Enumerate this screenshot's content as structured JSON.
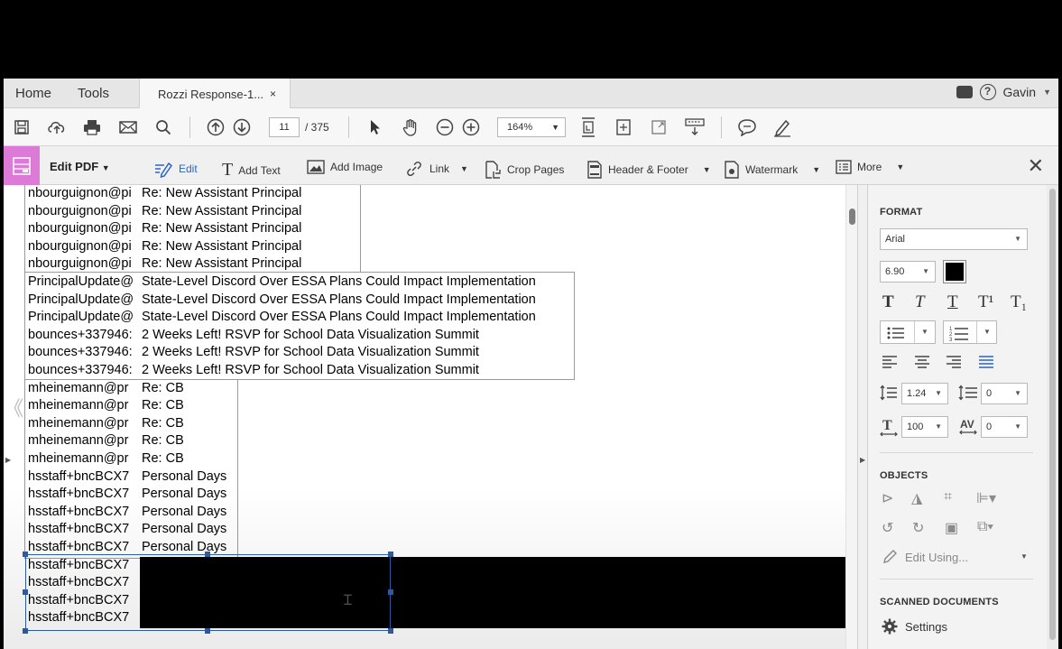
{
  "tabs": {
    "home": "Home",
    "tools": "Tools",
    "document_tab": "Rozzi Response-1...",
    "close_glyph": "×",
    "user": "Gavin"
  },
  "toolbar": {
    "page_current": "11",
    "page_total": "/ 375",
    "zoom": "164%"
  },
  "editbar": {
    "title": "Edit PDF",
    "edit": "Edit",
    "add_text": "Add Text",
    "add_image": "Add Image",
    "link": "Link",
    "crop_pages": "Crop Pages",
    "header_footer": "Header & Footer",
    "watermark": "Watermark",
    "more": "More"
  },
  "document": {
    "rows": [
      {
        "from": "nbourguignon@pi",
        "subject": "Re: New Assistant Principal"
      },
      {
        "from": "nbourguignon@pi",
        "subject": "Re: New Assistant Principal"
      },
      {
        "from": "nbourguignon@pi",
        "subject": "Re: New Assistant Principal"
      },
      {
        "from": "nbourguignon@pi",
        "subject": "Re: New Assistant Principal"
      },
      {
        "from": "nbourguignon@pi",
        "subject": "Re: New Assistant Principal"
      },
      {
        "from": "PrincipalUpdate@",
        "subject": "State-Level Discord Over ESSA Plans Could Impact Implementation"
      },
      {
        "from": "PrincipalUpdate@",
        "subject": "State-Level Discord Over ESSA Plans Could Impact Implementation"
      },
      {
        "from": "PrincipalUpdate@",
        "subject": "State-Level Discord Over ESSA Plans Could Impact Implementation"
      },
      {
        "from": "bounces+337946:",
        "subject": "2 Weeks Left! RSVP for School Data Visualization Summit"
      },
      {
        "from": "bounces+337946:",
        "subject": "2 Weeks Left! RSVP for School Data Visualization Summit"
      },
      {
        "from": "bounces+337946:",
        "subject": "2 Weeks Left! RSVP for School Data Visualization Summit"
      },
      {
        "from": "mheinemann@pr",
        "subject": "Re: CB"
      },
      {
        "from": "mheinemann@pr",
        "subject": "Re: CB"
      },
      {
        "from": "mheinemann@pr",
        "subject": "Re: CB"
      },
      {
        "from": "mheinemann@pr",
        "subject": "Re: CB"
      },
      {
        "from": "mheinemann@pr",
        "subject": "Re: CB"
      },
      {
        "from": "hsstaff+bncBCX7",
        "subject": "Personal Days"
      },
      {
        "from": "hsstaff+bncBCX7",
        "subject": "Personal Days"
      },
      {
        "from": "hsstaff+bncBCX7",
        "subject": "Personal Days"
      },
      {
        "from": "hsstaff+bncBCX7",
        "subject": "Personal Days"
      },
      {
        "from": "hsstaff+bncBCX7",
        "subject": "Personal Days"
      },
      {
        "from": "hsstaff+bncBCX7",
        "subject": ""
      },
      {
        "from": "hsstaff+bncBCX7",
        "subject": ""
      },
      {
        "from": "hsstaff+bncBCX7",
        "subject": ""
      },
      {
        "from": "hsstaff+bncBCX7",
        "subject": ""
      }
    ]
  },
  "panel": {
    "format_title": "FORMAT",
    "font": "Arial",
    "font_size": "6.90",
    "text_color": "#000000",
    "style_glyphs": [
      "T",
      "T",
      "T",
      "T¹",
      "T₁"
    ],
    "line_spacing": "1.24",
    "paragraph_spacing": "0",
    "horizontal_scale": "100",
    "char_spacing": "0",
    "char_spacing_label": "AV",
    "objects_title": "OBJECTS",
    "edit_using": "Edit Using...",
    "scanned_title": "SCANNED DOCUMENTS",
    "settings": "Settings"
  }
}
